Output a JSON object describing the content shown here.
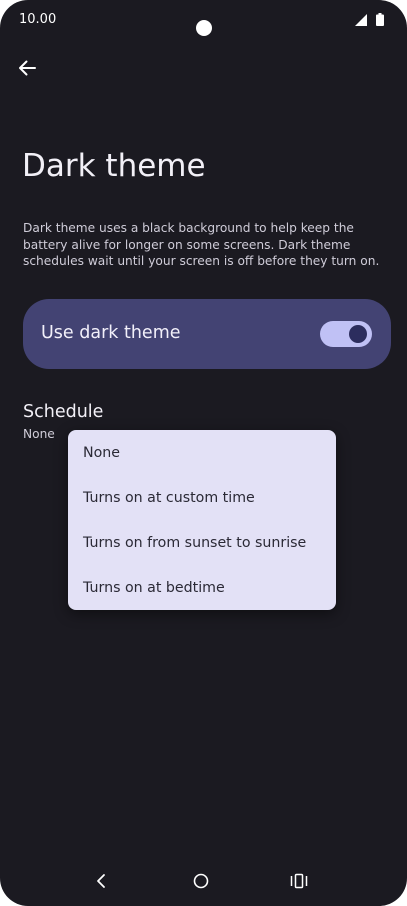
{
  "status_bar": {
    "time": "10.00"
  },
  "header": {
    "back_icon": "arrow-left-icon"
  },
  "page": {
    "title": "Dark theme",
    "description": "Dark theme uses a black background to help keep the battery alive for longer on some screens. Dark theme schedules wait until your screen is off before they turn on."
  },
  "dark_theme_toggle": {
    "label": "Use dark theme",
    "enabled": true
  },
  "schedule": {
    "title": "Schedule",
    "value": "None"
  },
  "schedule_menu": {
    "options": [
      "None",
      "Turns on at custom time",
      "Turns on from sunset to sunrise",
      "Turns on at bedtime"
    ]
  },
  "colors": {
    "background": "#1b1a21",
    "card": "#434373",
    "switch_track": "#c0c1f5",
    "switch_thumb": "#2c2d5e",
    "menu_background": "#e3e1f6"
  }
}
